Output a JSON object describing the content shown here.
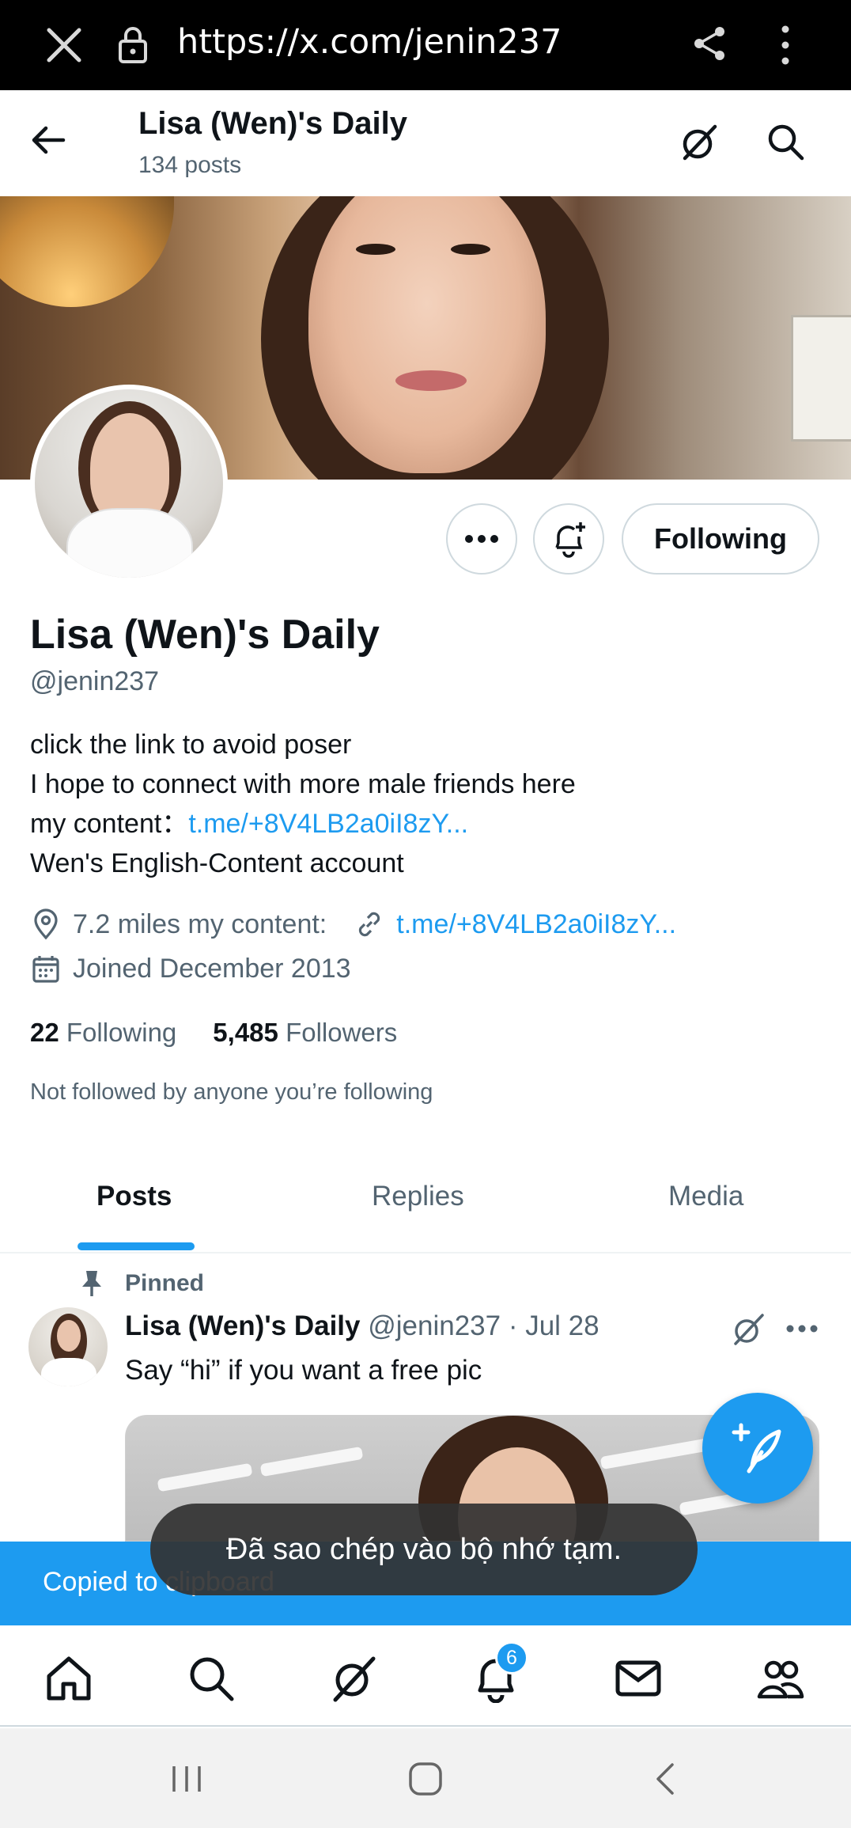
{
  "browser": {
    "url": "https://x.com/jenin237",
    "icons": [
      "close-icon",
      "lock-icon",
      "share-icon",
      "kebab-menu-icon"
    ]
  },
  "header": {
    "title": "Lisa (Wen)'s Daily",
    "post_count": "134 posts",
    "icons": [
      "back-arrow-icon",
      "grok-icon",
      "search-icon"
    ]
  },
  "profile": {
    "display_name": "Lisa (Wen)'s Daily",
    "handle": "@jenin237",
    "following_button": "Following",
    "bio": {
      "line1": "click the link to avoid poser",
      "line2": "I hope to connect with more male friends here",
      "line3_prefix": "my  content：",
      "line3_link": "t.me/+8V4LB2a0iI8zY...",
      "line4": "Wen's English-Content account"
    },
    "location": "7.2 miles  my  content:",
    "website": "t.me/+8V4LB2a0iI8zY...",
    "joined": "Joined December 2013",
    "following_count": "22",
    "following_label": "Following",
    "followers_count": "5,485",
    "followers_label": "Followers",
    "not_followed": "Not followed by anyone you’re following"
  },
  "tabs": [
    {
      "label": "Posts",
      "active": true
    },
    {
      "label": "Replies",
      "active": false
    },
    {
      "label": "Media",
      "active": false
    }
  ],
  "post": {
    "pinned_label": "Pinned",
    "author_name": "Lisa (Wen)'s Daily",
    "author_handle_date": "@jenin237 · Jul 28",
    "text": "Say “hi” if you want a free pic"
  },
  "copied_text": "Copied to clipboard",
  "toast": "Đã sao chép vào bộ nhớ tạm.",
  "bottom_nav": {
    "items": [
      "home-icon",
      "search-icon",
      "grok-icon",
      "notifications-icon",
      "messages-icon",
      "communities-icon"
    ],
    "notification_badge": "6"
  },
  "colors": {
    "accent": "#1d9bf0",
    "text_primary": "#0f1419",
    "text_secondary": "#536471"
  }
}
